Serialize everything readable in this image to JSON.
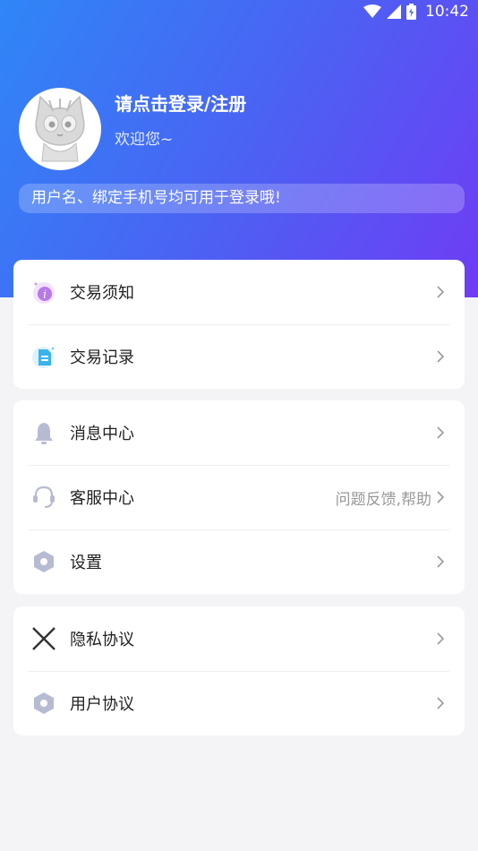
{
  "status_bar": {
    "time": "10:42",
    "icons": [
      "wifi-icon",
      "signal-icon",
      "battery-icon"
    ]
  },
  "profile": {
    "title": "请点击登录/注册",
    "subtitle": "欢迎您~",
    "avatar_icon": "cat-avatar-icon",
    "notice": "用户名、绑定手机号均可用于登录哦!"
  },
  "cards": [
    {
      "items": [
        {
          "label": "交易须知",
          "icon": "info-badge-icon"
        },
        {
          "label": "交易记录",
          "icon": "document-icon"
        }
      ]
    },
    {
      "items": [
        {
          "label": "消息中心",
          "icon": "bell-icon"
        },
        {
          "label": "客服中心",
          "icon": "headset-icon",
          "extra": "问题反馈,帮助"
        },
        {
          "label": "设置",
          "icon": "hexagon-settings-icon"
        }
      ]
    },
    {
      "items": [
        {
          "label": "隐私协议",
          "icon": "close-x-icon"
        },
        {
          "label": "用户协议",
          "icon": "hexagon-icon"
        }
      ]
    }
  ],
  "colors": {
    "gradient_start": "#2f86f7",
    "gradient_end": "#6f3cf4",
    "background": "#f4f4f6",
    "icon_gray": "#b7bbd2"
  }
}
